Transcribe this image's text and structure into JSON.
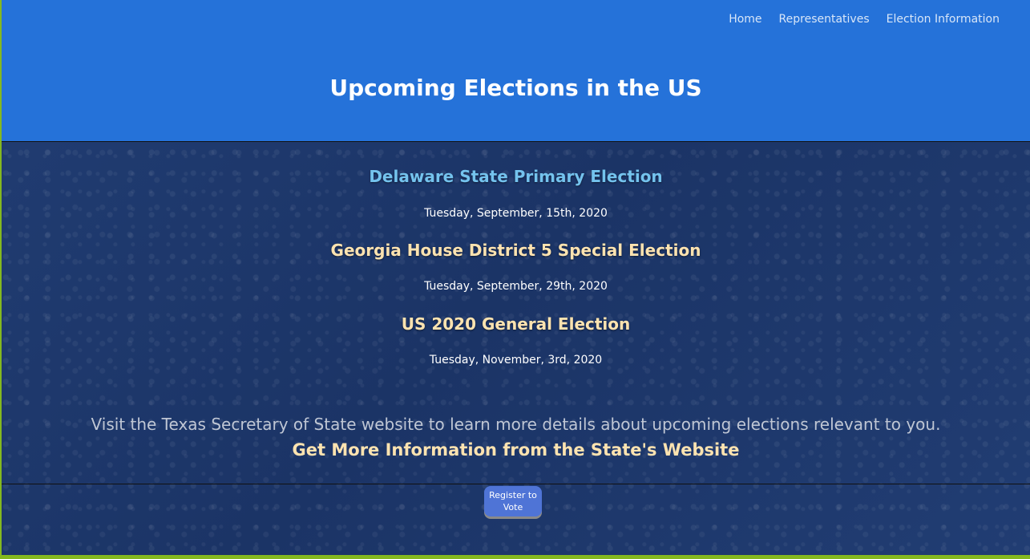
{
  "nav": {
    "items": [
      {
        "label": "Home"
      },
      {
        "label": "Representatives"
      },
      {
        "label": "Election Information"
      }
    ]
  },
  "header": {
    "title": "Upcoming Elections in the US"
  },
  "elections": [
    {
      "name": "Delaware State Primary Election",
      "date": "Tuesday, September, 15th, 2020",
      "color": "#74c3ee"
    },
    {
      "name": "Georgia House District 5 Special Election",
      "date": "Tuesday, September, 29th, 2020",
      "color": "#fde3b0"
    },
    {
      "name": "US 2020 General Election",
      "date": "Tuesday, November, 3rd, 2020",
      "color": "#fde3b0"
    }
  ],
  "info": {
    "visit_text": "Visit the Texas Secretary of State website to learn more details about upcoming elections relevant to you.",
    "state_link": "Get More Information from the State's Website"
  },
  "register": {
    "label": "Register to Vote"
  },
  "colors": {
    "header_bg": "#2572d9",
    "page_bg": "#1d3769",
    "accent_border": "#84b81f",
    "button_bg": "#4f74d6"
  }
}
